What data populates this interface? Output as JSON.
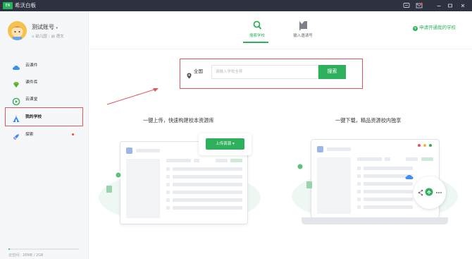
{
  "app": {
    "title": "希沃白板",
    "logo_text": "EN"
  },
  "user": {
    "name": "测试账号",
    "sub_school": "幼儿园",
    "sub_subject": "语文"
  },
  "sidebar": {
    "items": [
      {
        "label": "云课件",
        "icon": "cloud-icon"
      },
      {
        "label": "课件库",
        "icon": "diamond-icon"
      },
      {
        "label": "云课堂",
        "icon": "play-circle-icon"
      },
      {
        "label": "我的学校",
        "icon": "school-icon"
      },
      {
        "label": "探索",
        "icon": "rocket-icon"
      }
    ],
    "active_index": 3,
    "storage_text": "云空间：26MB / 2GB",
    "storage_used_fraction": 0.013
  },
  "tabs": [
    {
      "label": "搜索学校",
      "icon": "search-icon",
      "active": true
    },
    {
      "label": "输入邀请号",
      "icon": "flag-icon",
      "active": false
    }
  ],
  "apply_link": "申请开通我的学校",
  "search": {
    "region": "全国",
    "placeholder": "请输入学校全称",
    "button": "搜索"
  },
  "promo": {
    "left_headline": "一键上传，快速构建校本资源库",
    "right_headline": "一键下载，精品资源校内独享",
    "upload_button": "上传资源"
  },
  "colors": {
    "accent": "#2fb05d",
    "highlight": "#e0565a",
    "titlebar": "#2d3140"
  }
}
